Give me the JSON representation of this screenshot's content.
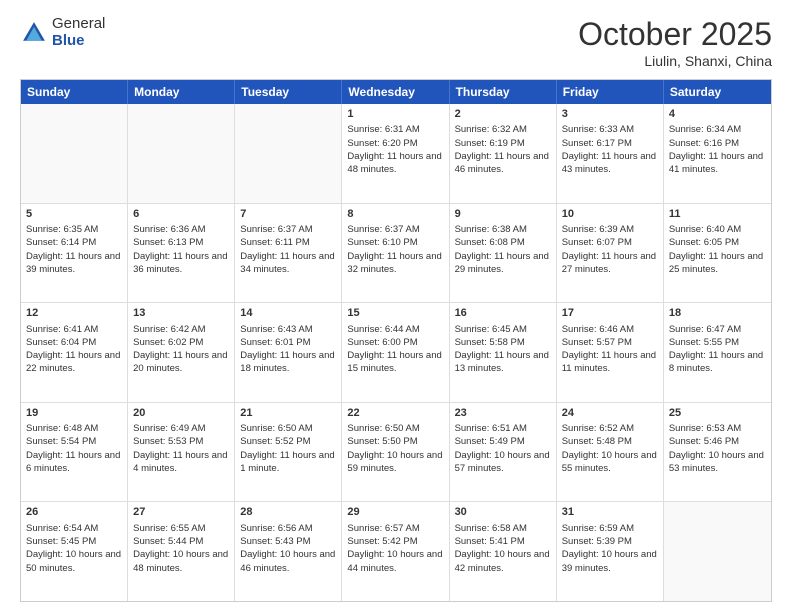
{
  "header": {
    "logo_general": "General",
    "logo_blue": "Blue",
    "month_title": "October 2025",
    "location": "Liulin, Shanxi, China"
  },
  "days_of_week": [
    "Sunday",
    "Monday",
    "Tuesday",
    "Wednesday",
    "Thursday",
    "Friday",
    "Saturday"
  ],
  "weeks": [
    [
      {
        "day": "",
        "info": "",
        "empty": true
      },
      {
        "day": "",
        "info": "",
        "empty": true
      },
      {
        "day": "",
        "info": "",
        "empty": true
      },
      {
        "day": "1",
        "info": "Sunrise: 6:31 AM\nSunset: 6:20 PM\nDaylight: 11 hours and 48 minutes.",
        "empty": false
      },
      {
        "day": "2",
        "info": "Sunrise: 6:32 AM\nSunset: 6:19 PM\nDaylight: 11 hours and 46 minutes.",
        "empty": false
      },
      {
        "day": "3",
        "info": "Sunrise: 6:33 AM\nSunset: 6:17 PM\nDaylight: 11 hours and 43 minutes.",
        "empty": false
      },
      {
        "day": "4",
        "info": "Sunrise: 6:34 AM\nSunset: 6:16 PM\nDaylight: 11 hours and 41 minutes.",
        "empty": false
      }
    ],
    [
      {
        "day": "5",
        "info": "Sunrise: 6:35 AM\nSunset: 6:14 PM\nDaylight: 11 hours and 39 minutes.",
        "empty": false
      },
      {
        "day": "6",
        "info": "Sunrise: 6:36 AM\nSunset: 6:13 PM\nDaylight: 11 hours and 36 minutes.",
        "empty": false
      },
      {
        "day": "7",
        "info": "Sunrise: 6:37 AM\nSunset: 6:11 PM\nDaylight: 11 hours and 34 minutes.",
        "empty": false
      },
      {
        "day": "8",
        "info": "Sunrise: 6:37 AM\nSunset: 6:10 PM\nDaylight: 11 hours and 32 minutes.",
        "empty": false
      },
      {
        "day": "9",
        "info": "Sunrise: 6:38 AM\nSunset: 6:08 PM\nDaylight: 11 hours and 29 minutes.",
        "empty": false
      },
      {
        "day": "10",
        "info": "Sunrise: 6:39 AM\nSunset: 6:07 PM\nDaylight: 11 hours and 27 minutes.",
        "empty": false
      },
      {
        "day": "11",
        "info": "Sunrise: 6:40 AM\nSunset: 6:05 PM\nDaylight: 11 hours and 25 minutes.",
        "empty": false
      }
    ],
    [
      {
        "day": "12",
        "info": "Sunrise: 6:41 AM\nSunset: 6:04 PM\nDaylight: 11 hours and 22 minutes.",
        "empty": false
      },
      {
        "day": "13",
        "info": "Sunrise: 6:42 AM\nSunset: 6:02 PM\nDaylight: 11 hours and 20 minutes.",
        "empty": false
      },
      {
        "day": "14",
        "info": "Sunrise: 6:43 AM\nSunset: 6:01 PM\nDaylight: 11 hours and 18 minutes.",
        "empty": false
      },
      {
        "day": "15",
        "info": "Sunrise: 6:44 AM\nSunset: 6:00 PM\nDaylight: 11 hours and 15 minutes.",
        "empty": false
      },
      {
        "day": "16",
        "info": "Sunrise: 6:45 AM\nSunset: 5:58 PM\nDaylight: 11 hours and 13 minutes.",
        "empty": false
      },
      {
        "day": "17",
        "info": "Sunrise: 6:46 AM\nSunset: 5:57 PM\nDaylight: 11 hours and 11 minutes.",
        "empty": false
      },
      {
        "day": "18",
        "info": "Sunrise: 6:47 AM\nSunset: 5:55 PM\nDaylight: 11 hours and 8 minutes.",
        "empty": false
      }
    ],
    [
      {
        "day": "19",
        "info": "Sunrise: 6:48 AM\nSunset: 5:54 PM\nDaylight: 11 hours and 6 minutes.",
        "empty": false
      },
      {
        "day": "20",
        "info": "Sunrise: 6:49 AM\nSunset: 5:53 PM\nDaylight: 11 hours and 4 minutes.",
        "empty": false
      },
      {
        "day": "21",
        "info": "Sunrise: 6:50 AM\nSunset: 5:52 PM\nDaylight: 11 hours and 1 minute.",
        "empty": false
      },
      {
        "day": "22",
        "info": "Sunrise: 6:50 AM\nSunset: 5:50 PM\nDaylight: 10 hours and 59 minutes.",
        "empty": false
      },
      {
        "day": "23",
        "info": "Sunrise: 6:51 AM\nSunset: 5:49 PM\nDaylight: 10 hours and 57 minutes.",
        "empty": false
      },
      {
        "day": "24",
        "info": "Sunrise: 6:52 AM\nSunset: 5:48 PM\nDaylight: 10 hours and 55 minutes.",
        "empty": false
      },
      {
        "day": "25",
        "info": "Sunrise: 6:53 AM\nSunset: 5:46 PM\nDaylight: 10 hours and 53 minutes.",
        "empty": false
      }
    ],
    [
      {
        "day": "26",
        "info": "Sunrise: 6:54 AM\nSunset: 5:45 PM\nDaylight: 10 hours and 50 minutes.",
        "empty": false
      },
      {
        "day": "27",
        "info": "Sunrise: 6:55 AM\nSunset: 5:44 PM\nDaylight: 10 hours and 48 minutes.",
        "empty": false
      },
      {
        "day": "28",
        "info": "Sunrise: 6:56 AM\nSunset: 5:43 PM\nDaylight: 10 hours and 46 minutes.",
        "empty": false
      },
      {
        "day": "29",
        "info": "Sunrise: 6:57 AM\nSunset: 5:42 PM\nDaylight: 10 hours and 44 minutes.",
        "empty": false
      },
      {
        "day": "30",
        "info": "Sunrise: 6:58 AM\nSunset: 5:41 PM\nDaylight: 10 hours and 42 minutes.",
        "empty": false
      },
      {
        "day": "31",
        "info": "Sunrise: 6:59 AM\nSunset: 5:39 PM\nDaylight: 10 hours and 39 minutes.",
        "empty": false
      },
      {
        "day": "",
        "info": "",
        "empty": true
      }
    ]
  ]
}
